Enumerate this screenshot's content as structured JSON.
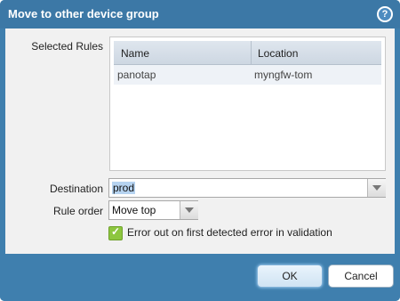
{
  "dialog": {
    "title": "Move to other device group",
    "help_icon": "question-mark-icon"
  },
  "form": {
    "selected_rules_label": "Selected Rules",
    "destination_label": "Destination",
    "rule_order_label": "Rule order",
    "destination_value": "prod",
    "rule_order_value": "Move top",
    "error_checkbox_label": "Error out on first detected error in validation",
    "error_checkbox_checked": true
  },
  "rules_table": {
    "columns": [
      "Name",
      "Location"
    ],
    "rows": [
      [
        "panotap",
        "myngfw-tom"
      ]
    ]
  },
  "buttons": {
    "ok": "OK",
    "cancel": "Cancel"
  },
  "colors": {
    "title_bar": "#3c78a6",
    "panel_bg": "#f1f1f1",
    "checkbox_green": "#8dc63f"
  }
}
